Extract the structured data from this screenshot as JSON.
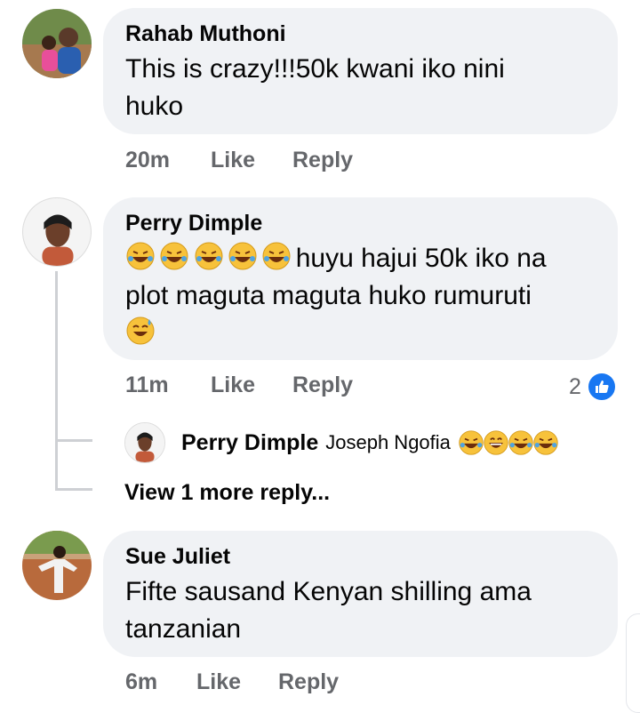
{
  "comments": [
    {
      "author": "Rahab Muthoni",
      "text_lines": [
        "This is crazy!!!50k kwani  iko nini",
        "huko"
      ],
      "time": "20m",
      "like_label": "Like",
      "reply_label": "Reply"
    },
    {
      "author": "Perry Dimple",
      "emoji_prefix": [
        "rofl",
        "rofl",
        "rofl",
        "rofl",
        "rofl"
      ],
      "text_lines": [
        "huyu hajui 50k iko na",
        "plot maguta maguta huko rumuruti"
      ],
      "emoji_suffix": "sweat-smile",
      "time": "11m",
      "like_label": "Like",
      "reply_label": "Reply",
      "reaction_count": "2",
      "reaction_icon": "like-thumb-icon"
    },
    {
      "author": "Sue Juliet",
      "text_lines": [
        "Fifte sausand Kenyan shilling ama",
        "tanzanian"
      ],
      "time": "6m",
      "like_label": "Like",
      "reply_label": "Reply"
    }
  ],
  "nested_reply": {
    "author": "Perry Dimple",
    "mention": "Joseph Ngofia",
    "emojis": [
      "rofl",
      "grin",
      "rofl",
      "rofl"
    ]
  },
  "view_more_replies": "View 1 more reply...",
  "colors": {
    "bubble": "#f0f2f5",
    "meta_text": "#65676b",
    "like_blue": "#1877f2",
    "thread_line": "#ced0d4"
  }
}
